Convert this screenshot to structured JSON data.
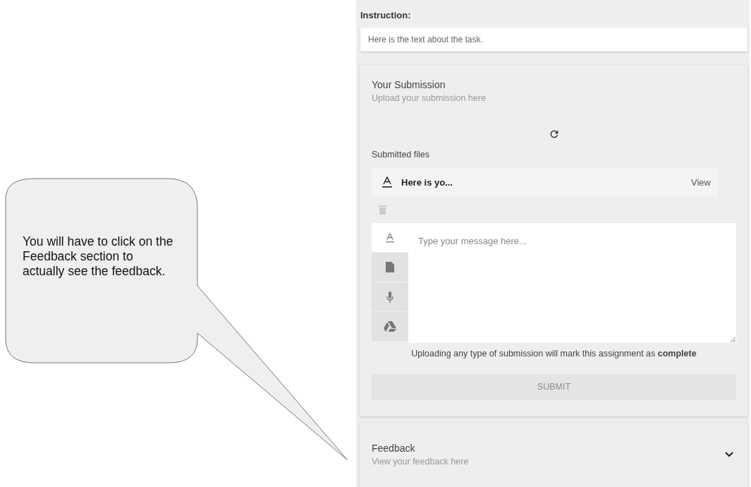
{
  "callout": {
    "text": "You will have to click on the Feedback section to actually see the feedback."
  },
  "instruction": {
    "label": "Instruction:",
    "text": "Here is the text about the task."
  },
  "submission": {
    "title": "Your Submission",
    "subtitle": "Upload your submission here",
    "files_label": "Submitted files",
    "files": [
      {
        "name": "Here is yo...",
        "action": "View"
      }
    ],
    "editor": {
      "tools": [
        {
          "kind": "text",
          "selected": true
        },
        {
          "kind": "file",
          "selected": false
        },
        {
          "kind": "mic",
          "selected": false
        },
        {
          "kind": "drive",
          "selected": false
        }
      ],
      "placeholder": "Type your message here..."
    },
    "note": "Uploading any type of submission will mark this assignment as **complete**",
    "submit": {
      "label": "SUBMIT",
      "disabled": true
    }
  },
  "feedback": {
    "title": "Feedback",
    "subtitle": "View your feedback here",
    "expanded": false
  }
}
